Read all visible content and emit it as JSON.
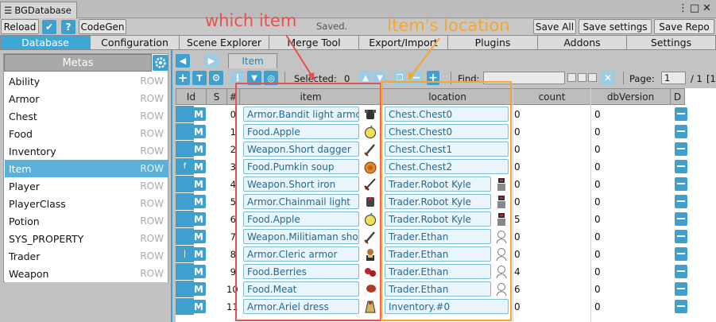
{
  "window": {
    "title": "BGDatabase"
  },
  "topbar": {
    "reload": "Reload",
    "codegen": "CodeGen",
    "saved_status": "Saved.",
    "save_all": "Save All",
    "save_settings": "Save settings",
    "save_repo": "Save Repo"
  },
  "nav": {
    "tabs": [
      "Database",
      "Configuration",
      "Scene Explorer",
      "Merge Tool",
      "Export/Import",
      "Plugins",
      "Addons",
      "Settings"
    ]
  },
  "metas": {
    "header": "Metas",
    "row_tag": "ROW",
    "items": [
      "Ability",
      "Armor",
      "Chest",
      "Food",
      "Inventory",
      "Item",
      "Player",
      "PlayerClass",
      "Potion",
      "SYS_PROPERTY",
      "Trader",
      "Weapon"
    ],
    "selected": "Item"
  },
  "breadcrumb": {
    "current": "Item"
  },
  "toolbar": {
    "selected_label": "Selected:",
    "selected_count": "0",
    "find_label": "Find:",
    "find_value": "",
    "page_label": "Page:",
    "page_value": "1",
    "page_total": "/ 1",
    "page_extra": "[1"
  },
  "grid": {
    "columns": [
      "Id",
      "S",
      "#",
      "item",
      "location",
      "count",
      "dbVersion",
      "D"
    ],
    "rows": [
      {
        "idflag": "",
        "index": "0",
        "item": "Armor.Bandit light armor",
        "location": "Chest.Chest0",
        "count": "0",
        "db": "0",
        "item_icon": "armor-icon",
        "loc_icon": ""
      },
      {
        "idflag": "",
        "index": "1",
        "item": "Food.Apple",
        "location": "Chest.Chest0",
        "count": "0",
        "db": "0",
        "item_icon": "apple-icon",
        "loc_icon": ""
      },
      {
        "idflag": "",
        "index": "2",
        "item": "Weapon.Short dagger",
        "location": "Chest.Chest1",
        "count": "0",
        "db": "0",
        "item_icon": "dagger-icon",
        "loc_icon": ""
      },
      {
        "idflag": "f",
        "index": "3",
        "item": "Food.Pumkin soup",
        "location": "Chest.Chest2",
        "count": "0",
        "db": "0",
        "item_icon": "soup-icon",
        "loc_icon": ""
      },
      {
        "idflag": "",
        "index": "4",
        "item": "Weapon.Short iron",
        "location": "Trader.Robot Kyle",
        "count": "0",
        "db": "0",
        "item_icon": "sword-icon",
        "loc_icon": "robot-icon"
      },
      {
        "idflag": "",
        "index": "5",
        "item": "Armor.Chainmail light",
        "location": "Trader.Robot Kyle",
        "count": "0",
        "db": "0",
        "item_icon": "chainmail-icon",
        "loc_icon": "robot-icon"
      },
      {
        "idflag": "",
        "index": "6",
        "item": "Food.Apple",
        "location": "Trader.Robot Kyle",
        "count": "5",
        "db": "0",
        "item_icon": "apple-icon",
        "loc_icon": "robot-icon"
      },
      {
        "idflag": "",
        "index": "7",
        "item": "Weapon.Militiaman short",
        "location": "Trader.Ethan",
        "count": "0",
        "db": "0",
        "item_icon": "dagger-icon",
        "loc_icon": "ethan-icon"
      },
      {
        "idflag": "|",
        "index": "8",
        "item": "Armor.Cleric armor",
        "location": "Trader.Ethan",
        "count": "0",
        "db": "0",
        "item_icon": "cleric-icon",
        "loc_icon": "ethan-icon"
      },
      {
        "idflag": "",
        "index": "9",
        "item": "Food.Berries",
        "location": "Trader.Ethan",
        "count": "4",
        "db": "0",
        "item_icon": "berries-icon",
        "loc_icon": "ethan-icon"
      },
      {
        "idflag": "",
        "index": "10",
        "item": "Food.Meat",
        "location": "Trader.Ethan",
        "count": "6",
        "db": "0",
        "item_icon": "meat-icon",
        "loc_icon": "ethan-icon"
      },
      {
        "idflag": "",
        "index": "11",
        "item": "Armor.Ariel dress",
        "location": "Inventory.#0",
        "count": "0",
        "db": "0",
        "item_icon": "dress-icon",
        "loc_icon": ""
      }
    ]
  },
  "annotations": {
    "item_label": "which item",
    "location_label": "Item's location"
  },
  "colors": {
    "accent": "#3fa0cf",
    "red_annot": "#e4524d",
    "orange_annot": "#f2a732"
  }
}
